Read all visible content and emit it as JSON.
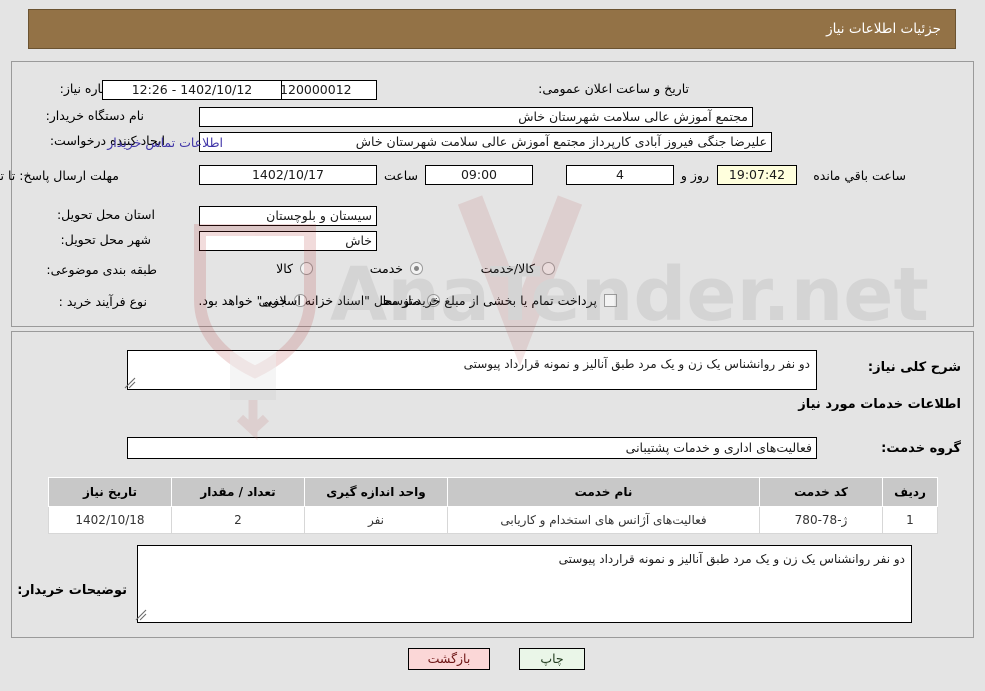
{
  "header": {
    "title": "جزئیات اطلاعات نیاز"
  },
  "form": {
    "need_number_label": "شماره نیاز:",
    "need_number_value": "1102093120000012",
    "announce_label": "تاریخ و ساعت اعلان عمومی:",
    "announce_value": "1402/10/12 - 12:26",
    "buyer_org_label": "نام دستگاه خریدار:",
    "buyer_org_value": "مجتمع آموزش عالی سلامت شهرستان خاش",
    "creator_label": "ایجاد کننده درخواست:",
    "creator_value": "علیرضا جنگی فیروز آبادی کارپرداز مجتمع آموزش عالی سلامت شهرستان خاش",
    "contact_link": "اطلاعات تماس خریدار",
    "deadline_label": "مهلت ارسال پاسخ: تا تاریخ:",
    "deadline_date": "1402/10/17",
    "time_label": "ساعت",
    "time_value": "09:00",
    "days_value": "4",
    "days_label": "روز و",
    "countdown_value": "19:07:42",
    "countdown_label": "ساعت باقي مانده",
    "province_label": "استان محل تحویل:",
    "province_value": "سیستان و بلوچستان",
    "city_label": "شهر محل تحویل:",
    "city_value": "خاش",
    "category_label": "طبقه بندی موضوعی:",
    "category_options": [
      {
        "label": "کالا",
        "selected": false
      },
      {
        "label": "خدمت",
        "selected": true
      },
      {
        "label": "کالا/خدمت",
        "selected": false
      }
    ],
    "process_label": "نوع فرآیند خرید :",
    "process_options": [
      {
        "label": "جزیی",
        "selected": false
      },
      {
        "label": "متوسط",
        "selected": true
      }
    ],
    "treasury_checkbox_checked": false,
    "treasury_note": "پرداخت تمام یا بخشی از مبلغ خرید،از محل \"اسناد خزانه اسلامی\" خواهد بود."
  },
  "middle": {
    "general_desc_label": "شرح کلی نیاز:",
    "general_desc_value": "دو نفر روانشناس یک زن و یک مرد طبق آنالیز و نمونه قرارداد پیوستی",
    "services_heading": "اطلاعات خدمات مورد نیاز",
    "service_group_label": "گروه خدمت:",
    "service_group_value": "فعالیت‌های اداری و خدمات پشتیبانی",
    "buyer_notes_label": "توضیحات خریدار:",
    "buyer_notes_value": "دو نفر روانشناس یک زن و یک مرد طبق آنالیز و نمونه قرارداد پیوستی"
  },
  "table": {
    "columns": [
      "ردیف",
      "کد خدمت",
      "نام خدمت",
      "واحد اندازه گیری",
      "تعداد / مقدار",
      "تاریخ نیاز"
    ],
    "rows": [
      {
        "row": "1",
        "code": "ژ-78-780",
        "name": "فعالیت‌های آژانس های استخدام و کاریابی",
        "unit": "نفر",
        "qty": "2",
        "date": "1402/10/18"
      }
    ]
  },
  "buttons": {
    "print": "چاپ",
    "back": "بازگشت"
  },
  "colors": {
    "header_bg": "#937246",
    "link": "#4035a8",
    "btn_print_bg": "#eaf6e8",
    "btn_back_bg": "#fbd7d7",
    "table_header_bg": "#c8c8c8",
    "countdown_bg": "#ffffdd"
  },
  "watermark": {
    "text": "AnaTender.net"
  }
}
